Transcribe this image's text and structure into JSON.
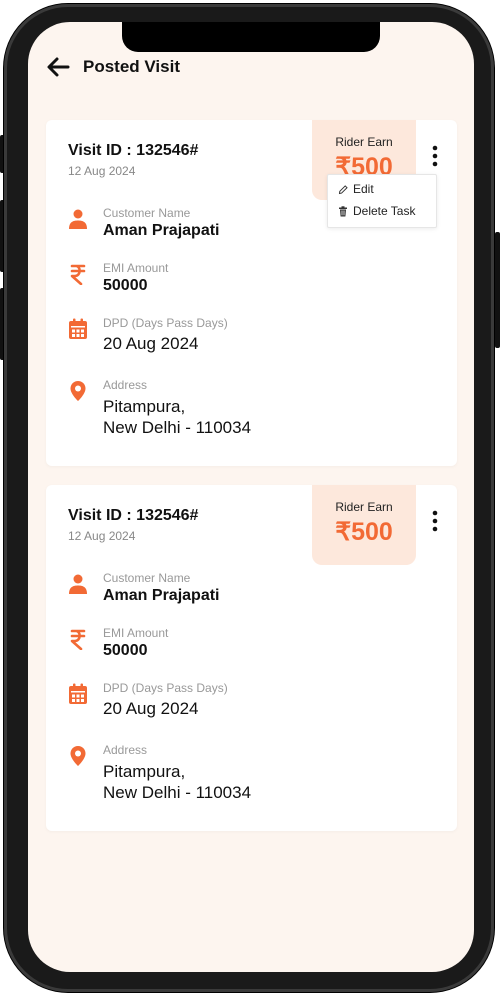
{
  "header": {
    "title": "Posted Visit"
  },
  "colors": {
    "accent": "#f26a35",
    "earn_bg": "#fde8dc",
    "screen_bg": "#fdf5ef"
  },
  "cards": [
    {
      "visit_id": "Visit ID : 132546#",
      "date": "12 Aug 2024",
      "rider_earn_label": "Rider Earn",
      "rider_earn_value": "₹500",
      "customer_label": "Customer Name",
      "customer_value": "Aman Prajapati",
      "emi_label": "EMI Amount",
      "emi_value": "50000",
      "dpd_label": "DPD (Days Pass Days)",
      "dpd_value": "20 Aug 2024",
      "address_label": "Address",
      "address_line1": "Pitampura,",
      "address_line2": "New Delhi - 110034"
    },
    {
      "visit_id": "Visit ID : 132546#",
      "date": "12 Aug 2024",
      "rider_earn_label": "Rider Earn",
      "rider_earn_value": "₹500",
      "customer_label": "Customer Name",
      "customer_value": "Aman Prajapati",
      "emi_label": "EMI Amount",
      "emi_value": "50000",
      "dpd_label": "DPD (Days Pass Days)",
      "dpd_value": "20 Aug 2024",
      "address_label": "Address",
      "address_line1": "Pitampura,",
      "address_line2": "New Delhi - 110034"
    }
  ],
  "menu": {
    "edit": "Edit",
    "delete": "Delete Task"
  },
  "icons": [
    "back-arrow-icon",
    "more-vertical-icon",
    "person-icon",
    "rupee-icon",
    "calendar-icon",
    "location-pin-icon",
    "pencil-icon",
    "trash-icon"
  ]
}
